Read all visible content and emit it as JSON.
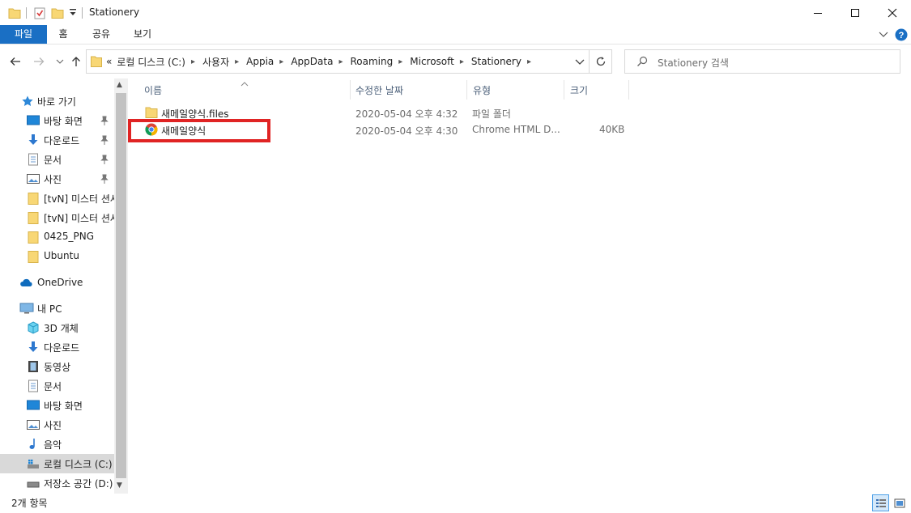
{
  "window": {
    "title": "Stationery"
  },
  "ribbon": {
    "tabs": [
      "파일",
      "홈",
      "공유",
      "보기"
    ]
  },
  "address": {
    "overflow": "«",
    "crumbs": [
      "로컬 디스크 (C:)",
      "사용자",
      "Appia",
      "AppData",
      "Roaming",
      "Microsoft",
      "Stationery"
    ]
  },
  "search": {
    "placeholder": "Stationery 검색"
  },
  "nav": {
    "quick_access": "바로 가기",
    "quick_items": [
      "바탕 화면",
      "다운로드",
      "문서",
      "사진",
      "[tvN] 미스터 션샤인",
      "[tvN] 미스터 션샤인",
      "0425_PNG",
      "Ubuntu"
    ],
    "onedrive": "OneDrive",
    "this_pc": "내 PC",
    "pc_items": [
      "3D 개체",
      "다운로드",
      "동영상",
      "문서",
      "바탕 화면",
      "사진",
      "음악",
      "로컬 디스크 (C:)",
      "저장소 공간 (D:)"
    ]
  },
  "columns": {
    "name": "이름",
    "date": "수정한 날짜",
    "type": "유형",
    "size": "크기"
  },
  "files": [
    {
      "name": "새메일양식.files",
      "date": "2020-05-04 오후 4:32",
      "type": "파일 폴더",
      "size": "",
      "icon": "folder-icon"
    },
    {
      "name": "새메일양식",
      "date": "2020-05-04 오후 4:30",
      "type": "Chrome HTML D...",
      "size": "40KB",
      "icon": "chrome-icon"
    }
  ],
  "status": {
    "count": "2개 항목"
  },
  "colors": {
    "accent": "#1a6fc4",
    "highlight": "#e02424",
    "folder": "#f8d775"
  }
}
